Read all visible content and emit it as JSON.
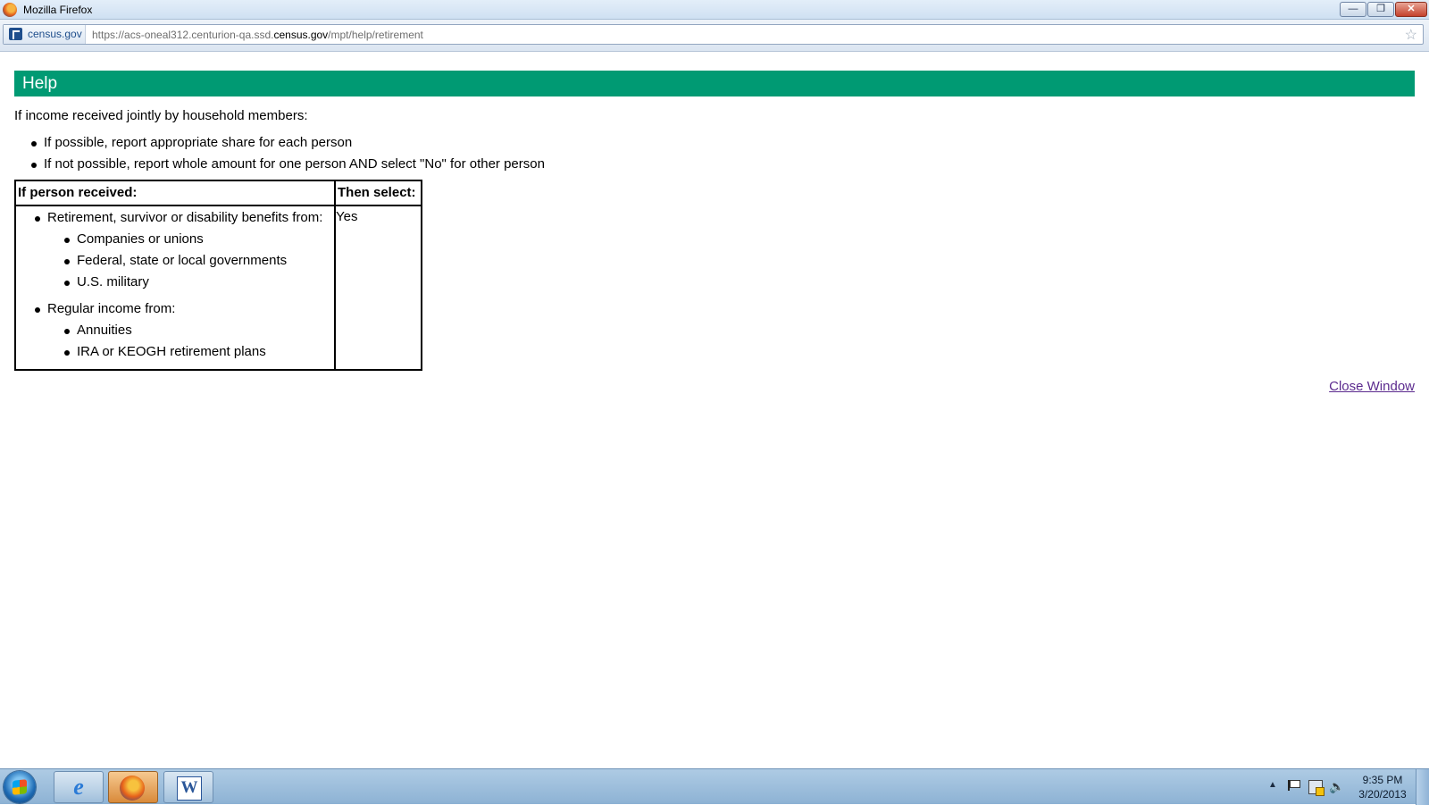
{
  "window": {
    "title": "Mozilla Firefox",
    "controls": {
      "minimize": "—",
      "maximize": "❐",
      "close": "✕"
    }
  },
  "navbar": {
    "site_identity": "census.gov",
    "url_prefix": "https://acs-oneal312.centurion-qa.ssd.",
    "url_domain": "census.gov",
    "url_path": "/mpt/help/retirement"
  },
  "page": {
    "header": "Help",
    "intro": "If income received jointly by household members:",
    "intro_items": [
      "If possible, report appropriate share for each person",
      "If not possible, report whole amount for one person AND select \"No\" for other person"
    ],
    "table": {
      "col1_header": "If person received:",
      "col2_header": "Then select:",
      "value": "Yes",
      "groups": [
        {
          "label": "Retirement, survivor or disability benefits from:",
          "items": [
            "Companies or unions",
            "Federal, state or local governments",
            "U.S. military"
          ]
        },
        {
          "label": "Regular income from:",
          "items": [
            "Annuities",
            "IRA or KEOGH retirement plans"
          ]
        }
      ]
    },
    "close_link": "Close Window"
  },
  "taskbar": {
    "clock_time": "9:35 PM",
    "clock_date": "3/20/2013",
    "word_label": "W",
    "ie_label": "e"
  },
  "colors": {
    "header_green": "#009a73",
    "link_visited": "#5b2a8e"
  }
}
